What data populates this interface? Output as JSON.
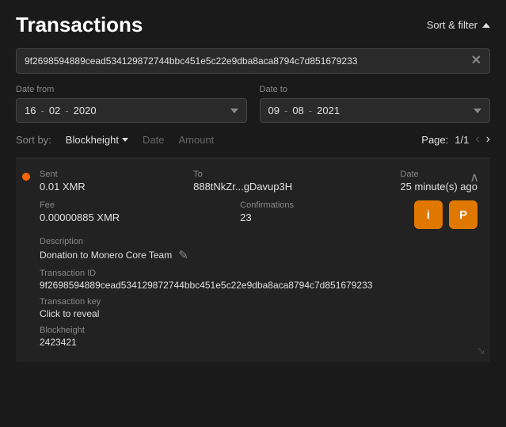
{
  "header": {
    "title": "Transactions",
    "sort_filter_label": "Sort & filter"
  },
  "search": {
    "tx_id": "9f2698594889cead534129872744bbc451e5c22e9dba8aca8794c7d851679233"
  },
  "date_from": {
    "label": "Date from",
    "day": "16",
    "sep1": "-",
    "month": "02",
    "sep2": "-",
    "year": "2020"
  },
  "date_to": {
    "label": "Date to",
    "day": "09",
    "sep1": "-",
    "month": "08",
    "sep2": "-",
    "year": "2021"
  },
  "sort_bar": {
    "label": "Sort by:",
    "blockheight": "Blockheight",
    "date": "Date",
    "amount": "Amount",
    "page_label": "Page:",
    "page_value": "1/1"
  },
  "transaction": {
    "sent_label": "Sent",
    "sent_value": "0.01 XMR",
    "to_label": "To",
    "to_value": "888tNkZr...gDavup3H",
    "date_label": "Date",
    "date_value": "25 minute(s) ago",
    "fee_label": "Fee",
    "fee_value": "0.00000885 XMR",
    "confirmations_label": "Confirmations",
    "confirmations_value": "23",
    "info_btn": "i",
    "proof_btn": "P",
    "desc_label": "Description",
    "desc_value": "Donation to Monero Core Team",
    "txid_label": "Transaction ID",
    "txid_value": "9f2698594889cead534129872744bbc451e5c22e9dba8aca8794c7d851679233",
    "key_label": "Transaction key",
    "key_value": "Click to reveal",
    "blockheight_label": "Blockheight",
    "blockheight_value": "2423421"
  }
}
